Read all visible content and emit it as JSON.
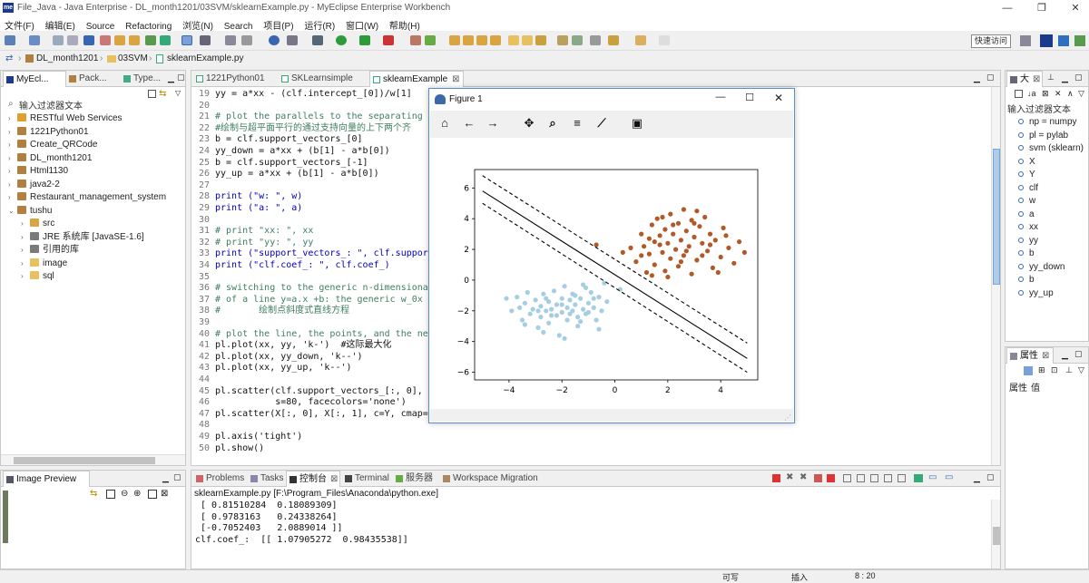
{
  "window": {
    "title": "File_Java - Java Enterprise - DL_month1201/03SVM/sklearnExample.py - MyEclipse Enterprise Workbench",
    "app_icon": "me",
    "min": "—",
    "max": "❐",
    "close": "✕"
  },
  "menu": [
    "文件(F)",
    "编辑(E)",
    "Source",
    "Refactoring",
    "浏览(N)",
    "Search",
    "项目(P)",
    "运行(R)",
    "窗口(W)",
    "帮助(H)"
  ],
  "toolbar": {
    "quick_access": "快速访问"
  },
  "breadcrumb": [
    "DL_month1201",
    "03SVM",
    "sklearnExample.py"
  ],
  "explorer": {
    "tabs": [
      "MyEcl...",
      "Pack...",
      "Type..."
    ],
    "filter_placeholder": "输入过滤器文本",
    "items": [
      {
        "label": "RESTful Web Services",
        "level": 0,
        "arrow": "›",
        "icon": "#e0a030"
      },
      {
        "label": "1221Python01",
        "level": 0,
        "arrow": "›",
        "icon": "#b08040"
      },
      {
        "label": "Create_QRCode",
        "level": 0,
        "arrow": "›",
        "icon": "#b08040"
      },
      {
        "label": "DL_month1201",
        "level": 0,
        "arrow": "›",
        "icon": "#b08040"
      },
      {
        "label": "Html1130",
        "level": 0,
        "arrow": "›",
        "icon": "#b08040"
      },
      {
        "label": "java2-2",
        "level": 0,
        "arrow": "›",
        "icon": "#b08040"
      },
      {
        "label": "Restaurant_management_system",
        "level": 0,
        "arrow": "›",
        "icon": "#b08040"
      },
      {
        "label": "tushu",
        "level": 0,
        "arrow": "⌄",
        "icon": "#b08040"
      },
      {
        "label": "src",
        "level": 1,
        "arrow": "›",
        "icon": "#d9a441"
      },
      {
        "label": "JRE 系统库 [JavaSE-1.6]",
        "level": 1,
        "arrow": "›",
        "icon": "#7a7a7a"
      },
      {
        "label": "引用的库",
        "level": 1,
        "arrow": "›",
        "icon": "#7a7a7a"
      },
      {
        "label": "image",
        "level": 1,
        "arrow": "›",
        "icon": "#e8c060"
      },
      {
        "label": "sql",
        "level": 1,
        "arrow": "›",
        "icon": "#e8c060"
      }
    ]
  },
  "image_preview": {
    "tab": "Image Preview"
  },
  "editor": {
    "tabs": [
      "1221Python01",
      "SKLearnsimple",
      "sklearnExample"
    ],
    "lines": [
      {
        "n": "19",
        "t": "yy = a*xx - (clf.intercept_[0])/w[1]    #",
        "c": "code"
      },
      {
        "n": "20",
        "t": "",
        "c": "code"
      },
      {
        "n": "21",
        "t": "# plot the parallels to the separating hy",
        "c": "cmt"
      },
      {
        "n": "22",
        "t": "#绘制与超平面平行的通过支持向量的上下两个齐",
        "c": "cmt"
      },
      {
        "n": "23",
        "t": "b = clf.support_vectors_[0]",
        "c": "code"
      },
      {
        "n": "24",
        "t": "yy_down = a*xx + (b[1] - a*b[0])",
        "c": "code"
      },
      {
        "n": "25",
        "t": "b = clf.support_vectors_[-1]",
        "c": "code"
      },
      {
        "n": "26",
        "t": "yy_up = a*xx + (b[1] - a*b[0])",
        "c": "code"
      },
      {
        "n": "27",
        "t": "",
        "c": "code"
      },
      {
        "n": "28",
        "t": "print (\"w: \", w)",
        "c": "print"
      },
      {
        "n": "29",
        "t": "print (\"a: \", a)",
        "c": "print"
      },
      {
        "n": "30",
        "t": "",
        "c": "code"
      },
      {
        "n": "31",
        "t": "# print \"xx: \", xx",
        "c": "cmt"
      },
      {
        "n": "32",
        "t": "# print \"yy: \", yy",
        "c": "cmt"
      },
      {
        "n": "33",
        "t": "print (\"support_vectors_: \", clf.support_",
        "c": "print"
      },
      {
        "n": "34",
        "t": "print (\"clf.coef_: \", clf.coef_)",
        "c": "print"
      },
      {
        "n": "35",
        "t": "",
        "c": "code"
      },
      {
        "n": "36",
        "t": "# switching to the generic n-dimensional",
        "c": "cmt"
      },
      {
        "n": "37",
        "t": "# of a line y=a.x +b: the generic w_0x +",
        "c": "cmt"
      },
      {
        "n": "38",
        "t": "#       绘制点斜度式直线方程",
        "c": "cmt"
      },
      {
        "n": "39",
        "t": "",
        "c": "code"
      },
      {
        "n": "40",
        "t": "# plot the line, the points, and the near",
        "c": "cmt"
      },
      {
        "n": "41",
        "t": "pl.plot(xx, yy, 'k-')  #这际最大化",
        "c": "code"
      },
      {
        "n": "42",
        "t": "pl.plot(xx, yy_down, 'k--')",
        "c": "code"
      },
      {
        "n": "43",
        "t": "pl.plot(xx, yy_up, 'k--')",
        "c": "code"
      },
      {
        "n": "44",
        "t": "",
        "c": "code"
      },
      {
        "n": "45",
        "t": "pl.scatter(clf.support_vectors_[:, 0], cl",
        "c": "code"
      },
      {
        "n": "46",
        "t": "           s=80, facecolors='none')",
        "c": "code"
      },
      {
        "n": "47",
        "t": "pl.scatter(X[:, 0], X[:, 1], c=Y, cmap=pl",
        "c": "code"
      },
      {
        "n": "48",
        "t": "",
        "c": "code"
      },
      {
        "n": "49",
        "t": "pl.axis('tight')",
        "c": "code"
      },
      {
        "n": "50",
        "t": "pl.show()",
        "c": "code"
      }
    ]
  },
  "figure": {
    "title": "Figure 1",
    "min": "—",
    "max": "☐",
    "close": "✕",
    "tools": [
      "home-icon",
      "back-icon",
      "forward-icon",
      "pan-icon",
      "zoom-icon",
      "configure-icon",
      "edit-axes-icon",
      "save-icon"
    ]
  },
  "chart_data": {
    "type": "scatter",
    "xlim": [
      -5.3,
      5.4
    ],
    "ylim": [
      -6.5,
      7.2
    ],
    "xticks": [
      -4,
      -2,
      0,
      2,
      4
    ],
    "yticks": [
      -6,
      -4,
      -2,
      0,
      2,
      4,
      6
    ],
    "lines": [
      {
        "name": "",
        "style": "solid",
        "x": [
          -5,
          5
        ],
        "y": [
          5.8,
          -5.1
        ]
      },
      {
        "name": "",
        "style": "dashed",
        "x": [
          -5,
          5
        ],
        "y": [
          6.8,
          -4.1
        ]
      },
      {
        "name": "",
        "style": "dashed",
        "x": [
          -5,
          5
        ],
        "y": [
          5.0,
          -6.0
        ]
      }
    ],
    "series": [
      {
        "color": "#a6cee3",
        "points": [
          [
            -4.1,
            -1.2
          ],
          [
            -3.9,
            -2.0
          ],
          [
            -3.6,
            -1.8
          ],
          [
            -3.5,
            -2.6
          ],
          [
            -3.4,
            -1.5
          ],
          [
            -3.3,
            -0.8
          ],
          [
            -3.2,
            -2.2
          ],
          [
            -3.1,
            -1.9
          ],
          [
            -3.0,
            -1.3
          ],
          [
            -2.9,
            -3.1
          ],
          [
            -2.8,
            -2.4
          ],
          [
            -2.8,
            -1.7
          ],
          [
            -2.7,
            -0.9
          ],
          [
            -2.6,
            -2.0
          ],
          [
            -2.5,
            -1.4
          ],
          [
            -2.5,
            -2.8
          ],
          [
            -2.4,
            -1.9
          ],
          [
            -2.3,
            -0.7
          ],
          [
            -2.2,
            -2.3
          ],
          [
            -2.2,
            -1.6
          ],
          [
            -2.1,
            -3.6
          ],
          [
            -2.0,
            -1.2
          ],
          [
            -2.0,
            -2.1
          ],
          [
            -1.9,
            -0.4
          ],
          [
            -1.8,
            -1.8
          ],
          [
            -1.8,
            -2.6
          ],
          [
            -1.7,
            -1.3
          ],
          [
            -1.6,
            -2.0
          ],
          [
            -1.6,
            -0.9
          ],
          [
            -1.5,
            -1.6
          ],
          [
            -1.4,
            -2.4
          ],
          [
            -1.4,
            -3.0
          ],
          [
            -1.3,
            -1.2
          ],
          [
            -1.2,
            -1.9
          ],
          [
            -1.2,
            -0.3
          ],
          [
            -1.1,
            -2.2
          ],
          [
            -1.0,
            -1.5
          ],
          [
            -0.9,
            -0.8
          ],
          [
            -0.8,
            -1.8
          ],
          [
            -0.7,
            -2.6
          ],
          [
            -0.6,
            -1.1
          ],
          [
            -0.5,
            -2.0
          ],
          [
            -0.4,
            -0.2
          ],
          [
            -0.3,
            -1.4
          ],
          [
            -3.7,
            -1.1
          ],
          [
            -2.9,
            -2.0
          ],
          [
            -2.6,
            -1.2
          ],
          [
            -2.4,
            -2.3
          ],
          [
            -2.0,
            -1.6
          ],
          [
            -1.7,
            -2.2
          ],
          [
            -1.5,
            -1.0
          ],
          [
            -1.3,
            -2.7
          ],
          [
            -1.0,
            -2.1
          ],
          [
            -0.8,
            -1.2
          ],
          [
            -2.7,
            -3.4
          ],
          [
            -3.4,
            -2.9
          ],
          [
            -1.9,
            -3.8
          ],
          [
            -0.6,
            -3.2
          ],
          [
            0.2,
            -0.6
          ],
          [
            -1.1,
            -0.5
          ]
        ]
      },
      {
        "color": "#b15928",
        "points": [
          [
            0.6,
            2.1
          ],
          [
            0.8,
            1.2
          ],
          [
            1.0,
            3.0
          ],
          [
            1.1,
            2.2
          ],
          [
            1.2,
            0.5
          ],
          [
            1.3,
            1.7
          ],
          [
            1.4,
            3.6
          ],
          [
            1.5,
            2.5
          ],
          [
            1.5,
            1.0
          ],
          [
            1.6,
            4.0
          ],
          [
            1.7,
            2.9
          ],
          [
            1.8,
            1.8
          ],
          [
            1.9,
            3.3
          ],
          [
            1.9,
            0.6
          ],
          [
            2.0,
            2.4
          ],
          [
            2.1,
            4.3
          ],
          [
            2.1,
            1.4
          ],
          [
            2.2,
            3.0
          ],
          [
            2.3,
            2.0
          ],
          [
            2.4,
            3.7
          ],
          [
            2.4,
            0.9
          ],
          [
            2.5,
            2.6
          ],
          [
            2.6,
            1.6
          ],
          [
            2.6,
            4.6
          ],
          [
            2.7,
            3.2
          ],
          [
            2.8,
            2.2
          ],
          [
            2.9,
            0.4
          ],
          [
            2.9,
            3.9
          ],
          [
            3.0,
            2.8
          ],
          [
            3.1,
            1.3
          ],
          [
            3.2,
            3.5
          ],
          [
            3.3,
            2.4
          ],
          [
            3.4,
            4.1
          ],
          [
            3.5,
            1.9
          ],
          [
            3.6,
            3.0
          ],
          [
            3.7,
            0.8
          ],
          [
            3.8,
            2.6
          ],
          [
            4.0,
            1.5
          ],
          [
            4.1,
            3.4
          ],
          [
            4.3,
            2.1
          ],
          [
            4.5,
            1.1
          ],
          [
            4.7,
            2.5
          ],
          [
            4.9,
            1.8
          ],
          [
            1.0,
            1.6
          ],
          [
            1.3,
            2.7
          ],
          [
            1.7,
            2.3
          ],
          [
            2.2,
            3.6
          ],
          [
            2.7,
            1.9
          ],
          [
            3.0,
            3.7
          ],
          [
            3.3,
            1.6
          ],
          [
            3.6,
            2.3
          ],
          [
            2.0,
            0.2
          ],
          [
            3.9,
            0.5
          ],
          [
            0.3,
            1.8
          ],
          [
            -0.7,
            2.3
          ],
          [
            1.4,
            0.3
          ],
          [
            2.5,
            1.2
          ],
          [
            4.2,
            2.9
          ],
          [
            3.1,
            4.5
          ],
          [
            1.8,
            4.1
          ]
        ]
      }
    ]
  },
  "console": {
    "tabs": [
      "Problems",
      "Tasks",
      "控制台",
      "Terminal",
      "服务器",
      "Workspace Migration"
    ],
    "header": "sklearnExample.py [F:\\Program_Files\\Anaconda\\python.exe]",
    "lines": [
      " [ 0.81510284  0.18089309]",
      " [ 0.9783163   0.24338264]",
      " [-0.7052403   2.0889014 ]]",
      "clf.coef_:  [[ 1.07905272  0.98435538]]"
    ]
  },
  "outline": {
    "tab": "大",
    "filter_placeholder": "输入过滤器文本",
    "items": [
      "np = numpy",
      "pl = pylab",
      "svm (sklearn)",
      "X",
      "Y",
      "clf",
      "w",
      "a",
      "xx",
      "yy",
      "b",
      "yy_down",
      "b",
      "yy_up"
    ]
  },
  "properties": {
    "tab": "属性",
    "cols": [
      "属性",
      "值"
    ]
  },
  "status": {
    "writable": "可写",
    "insert": "插入",
    "position": "8 : 20"
  }
}
